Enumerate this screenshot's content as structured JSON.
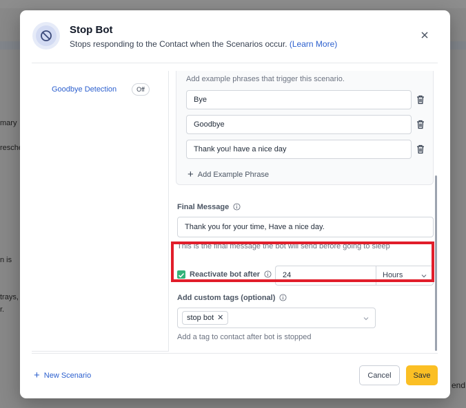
{
  "background": {
    "fragments": [
      "mary",
      "resche",
      "n is",
      "trays,",
      "r.",
      "end"
    ]
  },
  "modal": {
    "title": "Stop Bot",
    "subtitle": "Stops responding to the Contact when the Scenarios occur.",
    "learn_more": "(Learn More)",
    "close_icon": "close-icon"
  },
  "sidebar": {
    "items": [
      {
        "label": "Goodbye Detection",
        "toggle": "Off"
      }
    ],
    "new_scenario": "New Scenario"
  },
  "scenario": {
    "phrases_hint": "Add example phrases that trigger this scenario.",
    "phrases": [
      "Bye",
      "Goodbye",
      "Thank you! have a nice day"
    ],
    "add_phrase": "Add Example Phrase",
    "final_message_label": "Final Message",
    "final_message": "Thank you for your time, Have a nice day.",
    "final_message_hint": "This is the final message the bot will send before going to sleep",
    "reactivate_label": "Reactivate bot after",
    "reactivate_checked": true,
    "reactivate_value": "24",
    "reactivate_unit": "Hours",
    "tags_label": "Add custom tags (optional)",
    "tags": [
      "stop bot"
    ],
    "tags_hint": "Add a tag to contact after bot is stopped"
  },
  "footer": {
    "cancel": "Cancel",
    "save": "Save"
  },
  "colors": {
    "accent_link": "#2b5fce",
    "save_button": "#fbbf24",
    "checkbox": "#34b37a",
    "highlight_box": "#e11d2a"
  }
}
